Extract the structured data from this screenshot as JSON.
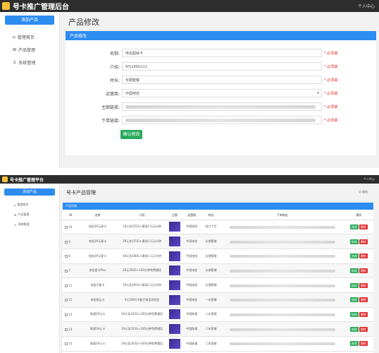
{
  "top": {
    "brand": "号卡推广管理后台",
    "user": "个人中心",
    "add_button": "添加产品",
    "nav": [
      {
        "icon": "home-icon",
        "label": "管理首页"
      },
      {
        "icon": "grid-icon",
        "label": "产品管理"
      },
      {
        "icon": "user-icon",
        "label": "系统管理"
      }
    ],
    "page_title": "产品修改",
    "card_title": "产品修改",
    "form": {
      "name": {
        "label": "名称:",
        "value": "电信超级卡",
        "hint": "* 必须填"
      },
      "intro": {
        "label": "介绍:",
        "value": "9元180G111",
        "hint": "* 必须填"
      },
      "duration": {
        "label": "时长:",
        "value": "长期套餐",
        "hint": "* 必须填"
      },
      "carrier": {
        "label": "运营商:",
        "value": "中国电信",
        "hint": "* 必须填"
      },
      "main_link": {
        "label": "主图链接:",
        "hint": "* 必须填"
      },
      "order_link": {
        "label": "下单链接:",
        "hint": "* 必须填"
      }
    },
    "submit": "确认修改"
  },
  "bottom": {
    "brand": "号卡推广管理平台",
    "user": "个人中心",
    "add_button": "添加产品",
    "nav": [
      {
        "icon": "home-icon",
        "label": "管理首页"
      },
      {
        "icon": "grid-icon",
        "label": "产品管理"
      },
      {
        "icon": "user-icon",
        "label": "系统管理"
      }
    ],
    "page_title": "号卡产品管理",
    "logout": "退出",
    "card_title": "产品列表",
    "columns": [
      "ID",
      "名称",
      "介绍",
      "主图",
      "运营商",
      "时长",
      "下单地址",
      "操作"
    ],
    "edit_label": "修改",
    "delete_label": "删除",
    "rows": [
      {
        "id": "10",
        "name": "电信29元星卡",
        "intro": "19元包155G+通话0.1元/分钟",
        "carrier": "中国电信",
        "duration": "前六个月"
      },
      {
        "id": "9",
        "name": "电信29元星卡",
        "intro": "29元包155G+通话0.1元/分钟",
        "carrier": "中国电信",
        "duration": "长期套餐"
      },
      {
        "id": "8",
        "name": "电信29元星卡",
        "intro": "39元包180G+通话0.1元/分钟",
        "carrier": "中国电信",
        "duration": "长期套餐"
      },
      {
        "id": "7",
        "name": "电信星卡Plus",
        "intro": "29元200G+100分钟免费通话",
        "carrier": "中国电信",
        "duration": "长期套餐"
      },
      {
        "id": "11",
        "name": "电信天星卡",
        "intro": "19元包200G+通话0.1元/分钟",
        "carrier": "中国电信",
        "duration": "长期套餐"
      },
      {
        "id": "12",
        "name": "电信星云卡",
        "intro": "9元180G不能打电话发短信",
        "carrier": "中国电信",
        "duration": "一年套餐"
      },
      {
        "id": "13",
        "name": "联通29元卡",
        "intro": "29元包203G+200分钟免费通话",
        "carrier": "中国联通",
        "duration": "二年套餐"
      },
      {
        "id": "14",
        "name": "联通19元卡",
        "intro": "19元包203G+100分钟免费通话",
        "carrier": "中国联通",
        "duration": "二年套餐"
      },
      {
        "id": "15",
        "name": "联通19元卡",
        "intro": "19元包203G+100分钟免费通话",
        "carrier": "中国联通",
        "duration": "二年套餐"
      }
    ]
  },
  "colors": {
    "accent": "#2d8cf0",
    "success": "#2aaa5c",
    "danger": "#e03030",
    "topbar": "#2d2d2d"
  }
}
